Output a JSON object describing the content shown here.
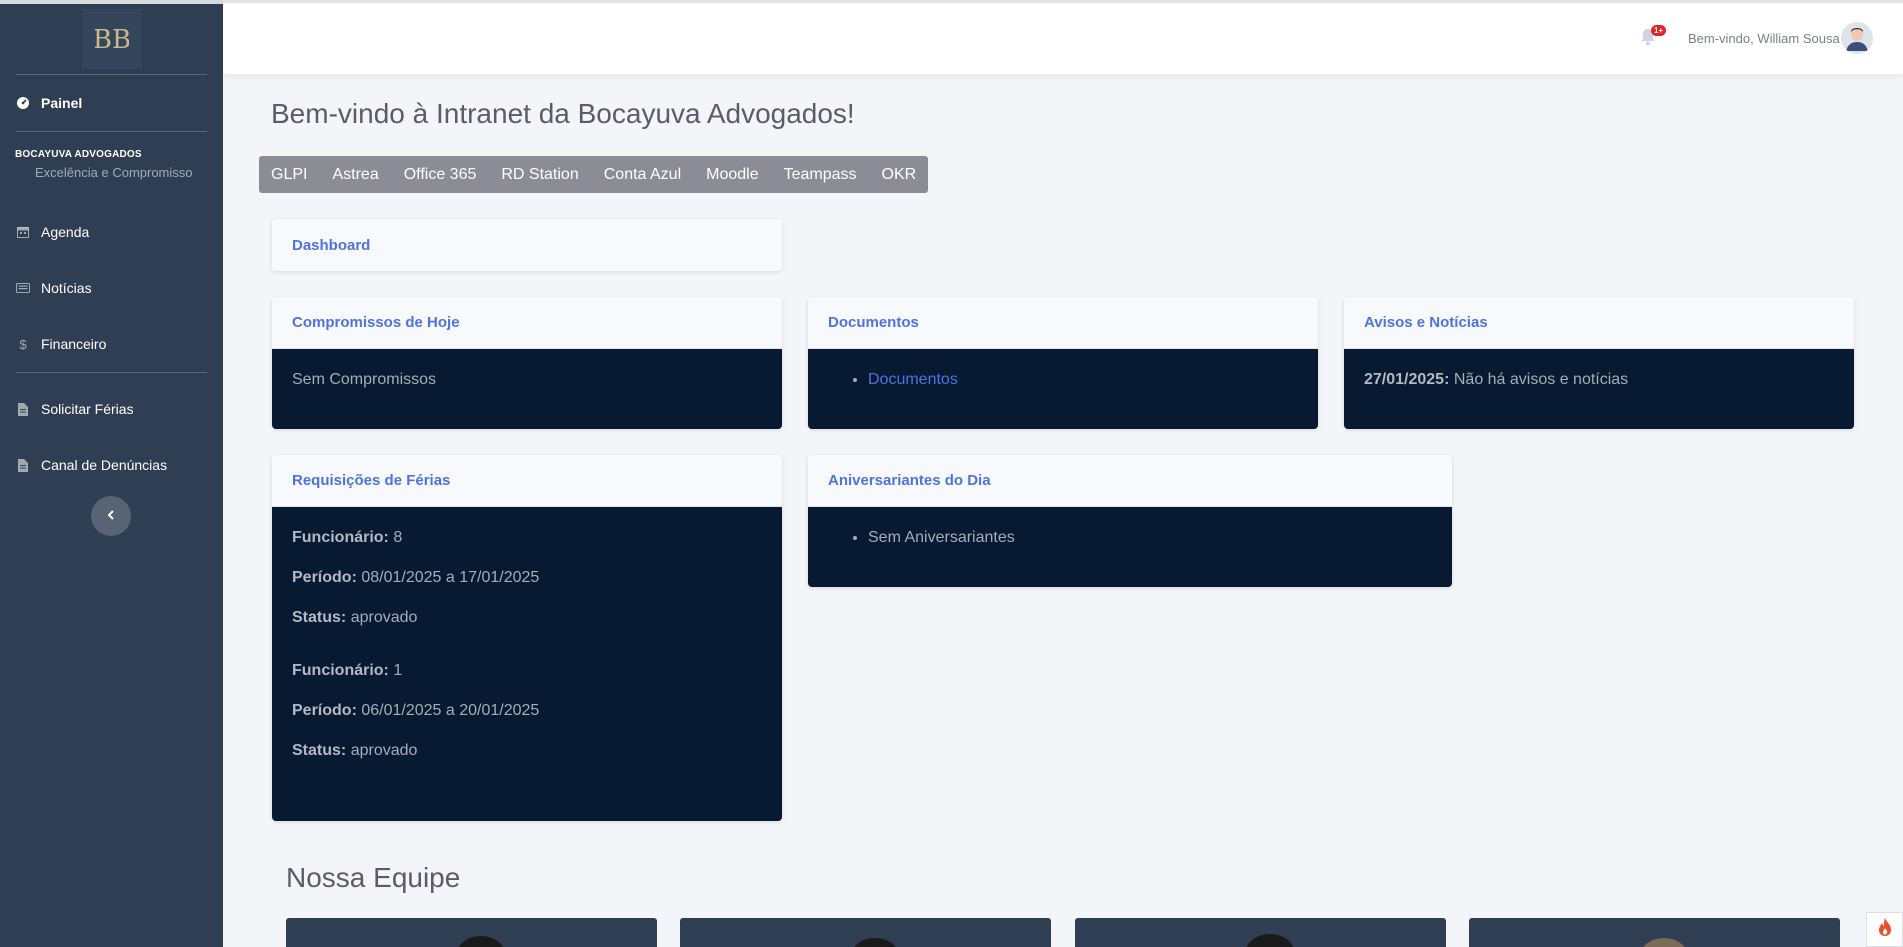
{
  "sidebar": {
    "brand_logo": "BB",
    "painel": "Painel",
    "section_title": "BOCAYUVA ADVOGADOS",
    "section_subtitle": "Excelência e Compromisso",
    "items": [
      {
        "label": "Agenda",
        "icon": "calendar-icon"
      },
      {
        "label": "Notícias",
        "icon": "newspaper-icon"
      },
      {
        "label": "Financeiro",
        "icon": "dollar-icon"
      },
      {
        "label": "Solicitar Férias",
        "icon": "file-icon"
      },
      {
        "label": "Canal de Denúncias",
        "icon": "file-icon"
      }
    ]
  },
  "topbar": {
    "badge": "1+",
    "welcome": "Bem-vindo, William Sousa"
  },
  "main": {
    "title": "Bem-vindo à Intranet da Bocayuva Advogados!",
    "apps": [
      "GLPI",
      "Astrea",
      "Office 365",
      "RD Station",
      "Conta Azul",
      "Moodle",
      "Teampass",
      "OKR"
    ],
    "dashboard_title": "Dashboard",
    "compromissos": {
      "title": "Compromissos de Hoje",
      "text": "Sem Compromissos"
    },
    "documentos": {
      "title": "Documentos",
      "link": "Documentos"
    },
    "avisos": {
      "title": "Avisos e Notícias",
      "date": "27/01/2025:",
      "text": "Não há avisos e notícias"
    },
    "ferias": {
      "title": "Requisições de Férias",
      "label_funcionario": "Funcionário:",
      "label_periodo": "Período:",
      "label_status": "Status:",
      "entries": [
        {
          "funcionario": "8",
          "periodo": "08/01/2025 a 17/01/2025",
          "status": "aprovado"
        },
        {
          "funcionario": "1",
          "periodo": "06/01/2025 a 20/01/2025",
          "status": "aprovado"
        }
      ]
    },
    "aniversariantes": {
      "title": "Aniversariantes do Dia",
      "text": "Sem Aniversariantes"
    },
    "team_title": "Nossa Equipe"
  },
  "colors": {
    "sidebar": "#2f3e52",
    "card_body": "#081a32",
    "accent": "#4e73df",
    "apps_bar": "#8c8c96"
  }
}
